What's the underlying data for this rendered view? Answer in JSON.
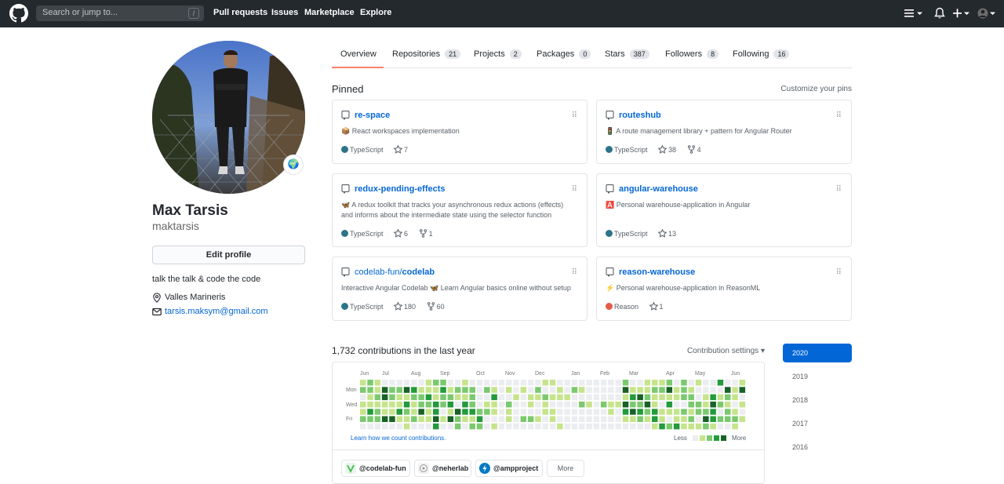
{
  "header": {
    "search_placeholder": "Search or jump to...",
    "search_key": "/",
    "nav": [
      "Pull requests",
      "Issues",
      "Marketplace",
      "Explore"
    ]
  },
  "profile": {
    "name": "Max Tarsis",
    "login": "maktarsis",
    "edit_label": "Edit profile",
    "bio": "talk the talk & code the code",
    "location": "Valles Marineris",
    "email": "tarsis.maksym@gmail.com",
    "status_emoji": "🌍"
  },
  "tabs": [
    {
      "label": "Overview",
      "count": ""
    },
    {
      "label": "Repositories",
      "count": "21"
    },
    {
      "label": "Projects",
      "count": "2"
    },
    {
      "label": "Packages",
      "count": "0"
    },
    {
      "label": "Stars",
      "count": "387"
    },
    {
      "label": "Followers",
      "count": "8"
    },
    {
      "label": "Following",
      "count": "16"
    }
  ],
  "pinned": {
    "title": "Pinned",
    "customize": "Customize your pins",
    "cards": [
      {
        "owner": "",
        "name": "re-space",
        "desc": "📦 React workspaces implementation",
        "language": "TypeScript",
        "lang_color": "#2b7489",
        "stars": "7",
        "forks": ""
      },
      {
        "owner": "",
        "name": "routeshub",
        "desc": "🚦 A route management library + pattern for Angular Router",
        "language": "TypeScript",
        "lang_color": "#2b7489",
        "stars": "38",
        "forks": "4"
      },
      {
        "owner": "",
        "name": "redux-pending-effects",
        "desc": "🦋 A redux toolkit that tracks your asynchronous redux actions (effects) and informs about the intermediate state using the selector function",
        "language": "TypeScript",
        "lang_color": "#2b7489",
        "stars": "6",
        "forks": "1"
      },
      {
        "owner": "",
        "name": "angular-warehouse",
        "desc": "🅰️ Personal warehouse-application in Angular",
        "language": "TypeScript",
        "lang_color": "#2b7489",
        "stars": "13",
        "forks": ""
      },
      {
        "owner": "codelab-fun/",
        "name": "codelab",
        "desc": "Interactive Angular Codelab 🦋 Learn Angular basics online without setup",
        "language": "TypeScript",
        "lang_color": "#2b7489",
        "stars": "180",
        "forks": "60"
      },
      {
        "owner": "",
        "name": "reason-warehouse",
        "desc": "⚡ Personal warehouse-application in ReasonML",
        "language": "Reason",
        "lang_color": "#e35c47",
        "stars": "1",
        "forks": ""
      }
    ]
  },
  "contributions": {
    "title": "1,732 contributions in the last year",
    "settings": "Contribution settings ▾",
    "months": [
      "Jun",
      "Jul",
      "Aug",
      "Sep",
      "Oct",
      "Nov",
      "Dec",
      "Jan",
      "Feb",
      "Mar",
      "Apr",
      "May",
      "Jun"
    ],
    "weekdays": [
      "Mon",
      "Wed",
      "Fri"
    ],
    "learn": "Learn how we count contributions.",
    "less": "Less",
    "more": "More",
    "levels": [
      "#ebedf0",
      "#c6e48b",
      "#7bc96f",
      "#239a3b",
      "#196127"
    ],
    "orgs": [
      "@codelab-fun",
      "@neherlab",
      "@ampproject"
    ],
    "orgs_more": "More"
  },
  "years": [
    "2020",
    "2019",
    "2018",
    "2017",
    "2016"
  ],
  "icons": {
    "logo": "github-logo-icon",
    "menu": "hamburger-icon",
    "bell": "bell-icon",
    "plus": "plus-icon",
    "repo": "repo-icon",
    "star": "star-icon",
    "fork": "fork-icon",
    "location": "location-icon",
    "mail": "mail-icon"
  }
}
